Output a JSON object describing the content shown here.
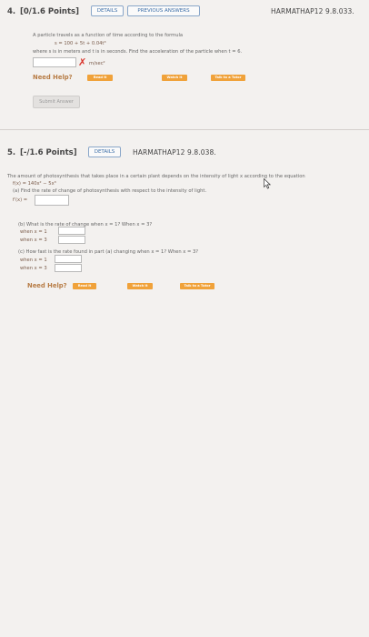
{
  "q4": {
    "number": "4.",
    "points": "[0/1.6 Points]",
    "details_label": "DETAILS",
    "previous_label": "PREVIOUS ANSWERS",
    "id": "HARMATHAP12 9.8.033.",
    "line1": "A particle travels as a function of time according to the formula",
    "formula": "s = 100 + 5t + 0.04t³",
    "line2": "where s is in meters and t is in seconds. Find the acceleration of the particle when  t = 6.",
    "wrong_mark": "✗",
    "unit": "m/sec²",
    "need_help": "Need Help?",
    "help_read": "Read It",
    "help_watch": "Watch It",
    "help_tutor": "Talk to a Tutor",
    "submit_label": "Submit Answer"
  },
  "q5": {
    "number": "5.",
    "points": "[-/1.6 Points]",
    "details_label": "DETAILS",
    "id": "HARMATHAP12 9.8.038.",
    "intro": "The amount of photosynthesis that takes place in a certain plant depends on the intensity of light x according to the equation",
    "formula": "f(x) = 140x² − 5x³",
    "part_a": "(a) Find the rate of change of photosynthesis with respect to the intensity of light.",
    "fprime": "f′(x) =",
    "part_b": "(b) What is the rate of change when  x = 1?  When  x = 3?",
    "when1": "when x = 1",
    "when3": "when x = 3",
    "part_c": "(c) How fast is the rate found in part (a) changing when  x = 1?  When  x = 3?",
    "need_help": "Need Help?",
    "help_read": "Read It",
    "help_watch": "Watch It",
    "help_tutor": "Talk to a Tutor"
  },
  "colors": {
    "accent_orange": "#f0a23a",
    "link_blue": "#3d6fa8",
    "error_red": "#d9342b"
  }
}
